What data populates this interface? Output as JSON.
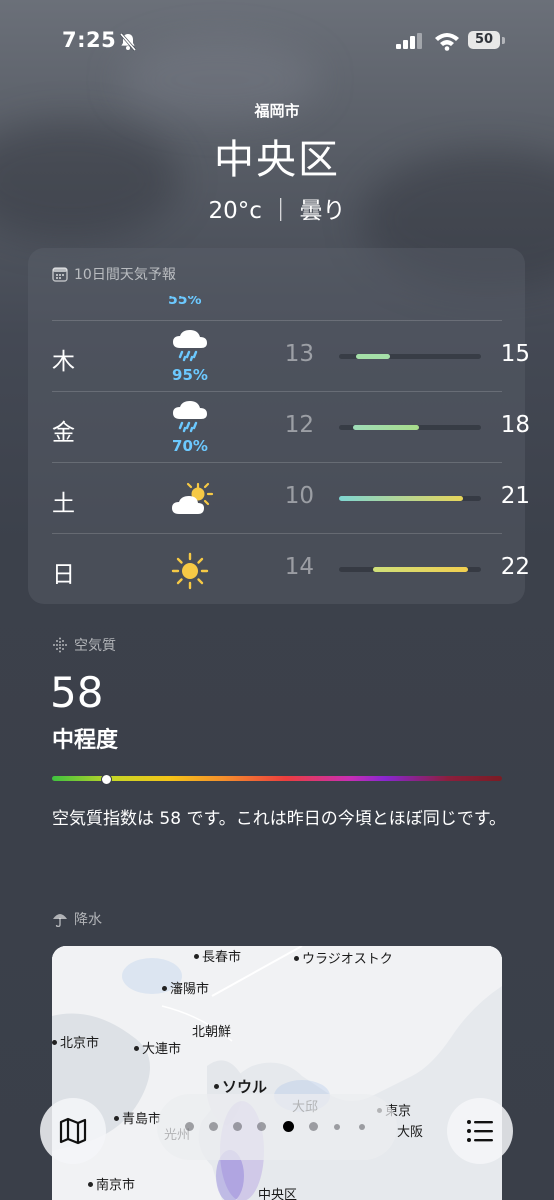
{
  "status_bar": {
    "time": "7:25",
    "battery": "50"
  },
  "location": {
    "city": "福岡市",
    "district": "中央区",
    "condition": "20°c ｜ 曇り"
  },
  "forecast": {
    "title": "10日間天気予報",
    "clipped_pop": "55%",
    "days": [
      {
        "day": "木",
        "icon": "rain-cloud-icon",
        "pop": "95%",
        "low": "13",
        "high": "15",
        "bar_start": 0.12,
        "bar_end": 0.36,
        "colors": [
          "#a5e0a8",
          "#a5e0a8"
        ]
      },
      {
        "day": "金",
        "icon": "rain-cloud-icon",
        "pop": "70%",
        "low": "12",
        "high": "18",
        "bar_start": 0.1,
        "bar_end": 0.56,
        "colors": [
          "#9fdcb8",
          "#a8dc8a"
        ]
      },
      {
        "day": "土",
        "icon": "sun-behind-cloud-icon",
        "pop": "",
        "low": "10",
        "high": "21",
        "bar_start": 0.0,
        "bar_end": 0.87,
        "colors": [
          "#7fd6d2",
          "#e8d65a"
        ]
      },
      {
        "day": "日",
        "icon": "sun-icon",
        "pop": "",
        "low": "14",
        "high": "22",
        "bar_start": 0.24,
        "bar_end": 0.91,
        "colors": [
          "#cfe07a",
          "#f2cf4f"
        ]
      }
    ]
  },
  "air_quality": {
    "title": "空気質",
    "value": "58",
    "level": "中程度",
    "indicator_position": 0.12,
    "description": "空気質指数は 58 です。これは昨日の今頃とほぼ同じです。"
  },
  "precipitation": {
    "title": "降水",
    "map_labels": [
      "長春市",
      "ウラジオストク",
      "瀋陽市",
      "北朝鮮",
      "北京市",
      "大連市",
      "ソウル",
      "青島市",
      "東京",
      "大阪",
      "南京市",
      "中央区",
      "大邱",
      "光州"
    ]
  },
  "pager": {
    "count": 8,
    "active_index": 4
  }
}
